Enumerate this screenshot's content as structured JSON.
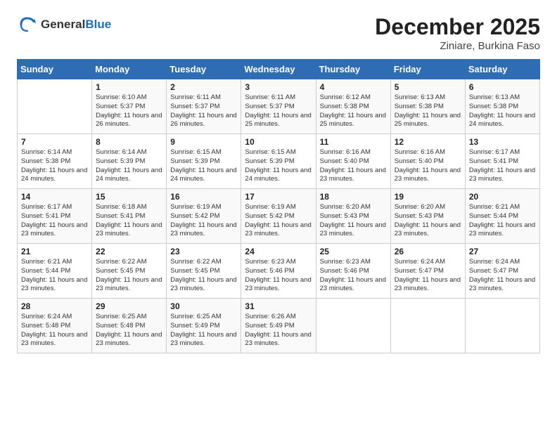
{
  "logo": {
    "general": "General",
    "blue": "Blue"
  },
  "header": {
    "month": "December 2025",
    "location": "Ziniare, Burkina Faso"
  },
  "days_of_week": [
    "Sunday",
    "Monday",
    "Tuesday",
    "Wednesday",
    "Thursday",
    "Friday",
    "Saturday"
  ],
  "weeks": [
    [
      {
        "day": "",
        "sunrise": "",
        "sunset": "",
        "daylight": ""
      },
      {
        "day": "1",
        "sunrise": "Sunrise: 6:10 AM",
        "sunset": "Sunset: 5:37 PM",
        "daylight": "Daylight: 11 hours and 26 minutes."
      },
      {
        "day": "2",
        "sunrise": "Sunrise: 6:11 AM",
        "sunset": "Sunset: 5:37 PM",
        "daylight": "Daylight: 11 hours and 26 minutes."
      },
      {
        "day": "3",
        "sunrise": "Sunrise: 6:11 AM",
        "sunset": "Sunset: 5:37 PM",
        "daylight": "Daylight: 11 hours and 25 minutes."
      },
      {
        "day": "4",
        "sunrise": "Sunrise: 6:12 AM",
        "sunset": "Sunset: 5:38 PM",
        "daylight": "Daylight: 11 hours and 25 minutes."
      },
      {
        "day": "5",
        "sunrise": "Sunrise: 6:13 AM",
        "sunset": "Sunset: 5:38 PM",
        "daylight": "Daylight: 11 hours and 25 minutes."
      },
      {
        "day": "6",
        "sunrise": "Sunrise: 6:13 AM",
        "sunset": "Sunset: 5:38 PM",
        "daylight": "Daylight: 11 hours and 24 minutes."
      }
    ],
    [
      {
        "day": "7",
        "sunrise": "Sunrise: 6:14 AM",
        "sunset": "Sunset: 5:38 PM",
        "daylight": "Daylight: 11 hours and 24 minutes."
      },
      {
        "day": "8",
        "sunrise": "Sunrise: 6:14 AM",
        "sunset": "Sunset: 5:39 PM",
        "daylight": "Daylight: 11 hours and 24 minutes."
      },
      {
        "day": "9",
        "sunrise": "Sunrise: 6:15 AM",
        "sunset": "Sunset: 5:39 PM",
        "daylight": "Daylight: 11 hours and 24 minutes."
      },
      {
        "day": "10",
        "sunrise": "Sunrise: 6:15 AM",
        "sunset": "Sunset: 5:39 PM",
        "daylight": "Daylight: 11 hours and 24 minutes."
      },
      {
        "day": "11",
        "sunrise": "Sunrise: 6:16 AM",
        "sunset": "Sunset: 5:40 PM",
        "daylight": "Daylight: 11 hours and 23 minutes."
      },
      {
        "day": "12",
        "sunrise": "Sunrise: 6:16 AM",
        "sunset": "Sunset: 5:40 PM",
        "daylight": "Daylight: 11 hours and 23 minutes."
      },
      {
        "day": "13",
        "sunrise": "Sunrise: 6:17 AM",
        "sunset": "Sunset: 5:41 PM",
        "daylight": "Daylight: 11 hours and 23 minutes."
      }
    ],
    [
      {
        "day": "14",
        "sunrise": "Sunrise: 6:17 AM",
        "sunset": "Sunset: 5:41 PM",
        "daylight": "Daylight: 11 hours and 23 minutes."
      },
      {
        "day": "15",
        "sunrise": "Sunrise: 6:18 AM",
        "sunset": "Sunset: 5:41 PM",
        "daylight": "Daylight: 11 hours and 23 minutes."
      },
      {
        "day": "16",
        "sunrise": "Sunrise: 6:19 AM",
        "sunset": "Sunset: 5:42 PM",
        "daylight": "Daylight: 11 hours and 23 minutes."
      },
      {
        "day": "17",
        "sunrise": "Sunrise: 6:19 AM",
        "sunset": "Sunset: 5:42 PM",
        "daylight": "Daylight: 11 hours and 23 minutes."
      },
      {
        "day": "18",
        "sunrise": "Sunrise: 6:20 AM",
        "sunset": "Sunset: 5:43 PM",
        "daylight": "Daylight: 11 hours and 23 minutes."
      },
      {
        "day": "19",
        "sunrise": "Sunrise: 6:20 AM",
        "sunset": "Sunset: 5:43 PM",
        "daylight": "Daylight: 11 hours and 23 minutes."
      },
      {
        "day": "20",
        "sunrise": "Sunrise: 6:21 AM",
        "sunset": "Sunset: 5:44 PM",
        "daylight": "Daylight: 11 hours and 23 minutes."
      }
    ],
    [
      {
        "day": "21",
        "sunrise": "Sunrise: 6:21 AM",
        "sunset": "Sunset: 5:44 PM",
        "daylight": "Daylight: 11 hours and 23 minutes."
      },
      {
        "day": "22",
        "sunrise": "Sunrise: 6:22 AM",
        "sunset": "Sunset: 5:45 PM",
        "daylight": "Daylight: 11 hours and 23 minutes."
      },
      {
        "day": "23",
        "sunrise": "Sunrise: 6:22 AM",
        "sunset": "Sunset: 5:45 PM",
        "daylight": "Daylight: 11 hours and 23 minutes."
      },
      {
        "day": "24",
        "sunrise": "Sunrise: 6:23 AM",
        "sunset": "Sunset: 5:46 PM",
        "daylight": "Daylight: 11 hours and 23 minutes."
      },
      {
        "day": "25",
        "sunrise": "Sunrise: 6:23 AM",
        "sunset": "Sunset: 5:46 PM",
        "daylight": "Daylight: 11 hours and 23 minutes."
      },
      {
        "day": "26",
        "sunrise": "Sunrise: 6:24 AM",
        "sunset": "Sunset: 5:47 PM",
        "daylight": "Daylight: 11 hours and 23 minutes."
      },
      {
        "day": "27",
        "sunrise": "Sunrise: 6:24 AM",
        "sunset": "Sunset: 5:47 PM",
        "daylight": "Daylight: 11 hours and 23 minutes."
      }
    ],
    [
      {
        "day": "28",
        "sunrise": "Sunrise: 6:24 AM",
        "sunset": "Sunset: 5:48 PM",
        "daylight": "Daylight: 11 hours and 23 minutes."
      },
      {
        "day": "29",
        "sunrise": "Sunrise: 6:25 AM",
        "sunset": "Sunset: 5:48 PM",
        "daylight": "Daylight: 11 hours and 23 minutes."
      },
      {
        "day": "30",
        "sunrise": "Sunrise: 6:25 AM",
        "sunset": "Sunset: 5:49 PM",
        "daylight": "Daylight: 11 hours and 23 minutes."
      },
      {
        "day": "31",
        "sunrise": "Sunrise: 6:26 AM",
        "sunset": "Sunset: 5:49 PM",
        "daylight": "Daylight: 11 hours and 23 minutes."
      },
      {
        "day": "",
        "sunrise": "",
        "sunset": "",
        "daylight": ""
      },
      {
        "day": "",
        "sunrise": "",
        "sunset": "",
        "daylight": ""
      },
      {
        "day": "",
        "sunrise": "",
        "sunset": "",
        "daylight": ""
      }
    ]
  ]
}
